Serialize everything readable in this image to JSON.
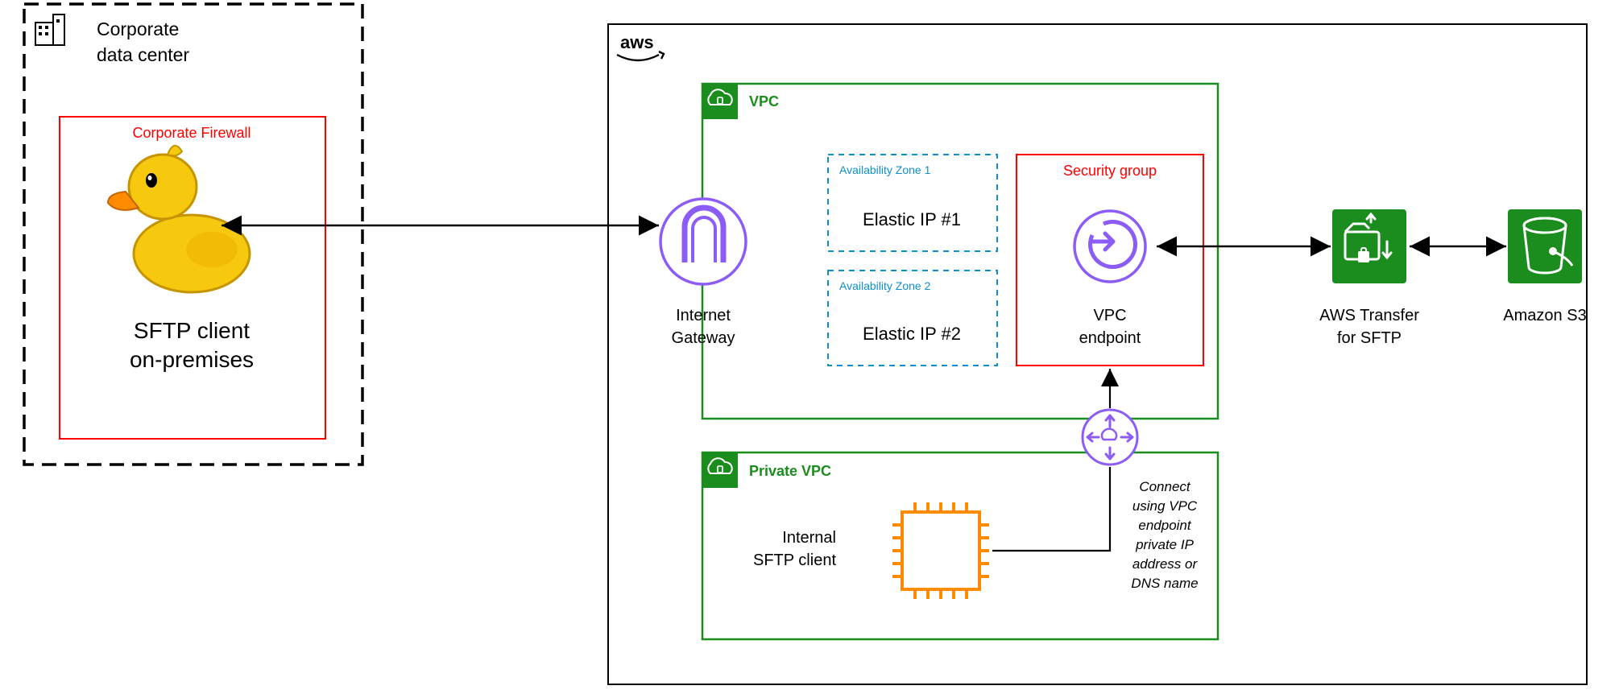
{
  "corporate": {
    "title_line1": "Corporate",
    "title_line2": "data center",
    "firewall_label": "Corporate Firewall",
    "client_line1": "SFTP client",
    "client_line2": "on-premises"
  },
  "aws": {
    "logo_text": "aws",
    "vpc_label": "VPC",
    "private_vpc_label": "Private VPC",
    "internet_gateway": {
      "line1": "Internet",
      "line2": "Gateway"
    },
    "az1": {
      "title": "Availability Zone 1",
      "elastic": "Elastic IP #1"
    },
    "az2": {
      "title": "Availability Zone 2",
      "elastic": "Elastic IP #2"
    },
    "security_group": "Security group",
    "vpc_endpoint": {
      "line1": "VPC",
      "line2": "endpoint"
    },
    "internal_client": {
      "line1": "Internal",
      "line2": "SFTP client"
    },
    "note": {
      "l1": "Connect",
      "l2": "using VPC",
      "l3": "endpoint",
      "l4": "private IP",
      "l5": "address or",
      "l6": "DNS name"
    },
    "transfer": {
      "line1": "AWS Transfer",
      "line2": "for SFTP"
    },
    "s3": "Amazon S3"
  }
}
